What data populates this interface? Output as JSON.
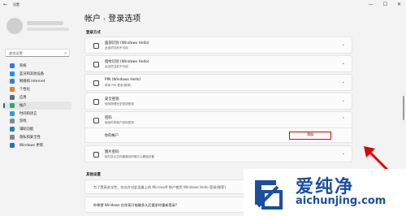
{
  "window": {
    "title": "设置",
    "controls": [
      "—",
      "☐",
      "✕"
    ],
    "back": "←"
  },
  "search": {
    "placeholder": "查找设置"
  },
  "sidebar": {
    "items": [
      {
        "label": "系统",
        "color": "#2b7de9"
      },
      {
        "label": "蓝牙和其他设备",
        "color": "#1e90ff"
      },
      {
        "label": "网络和 Internet",
        "color": "#3a7bd5"
      },
      {
        "label": "个性化",
        "color": "#e67e22"
      },
      {
        "label": "应用",
        "color": "#5a6c86"
      },
      {
        "label": "帐户",
        "color": "#27ae60"
      },
      {
        "label": "时间和语言",
        "color": "#2d9cdb"
      },
      {
        "label": "游戏",
        "color": "#7f8c8d"
      },
      {
        "label": "辅助功能",
        "color": "#2980b9"
      },
      {
        "label": "隐私和安全性",
        "color": "#7f8c8d"
      },
      {
        "label": "Windows 更新",
        "color": "#1e73be"
      }
    ],
    "active_index": 5
  },
  "breadcrumb": {
    "parent": "帐户",
    "separator": "›",
    "current": "登录选项"
  },
  "sections": {
    "signin": "登录方式",
    "additional": "其他设置"
  },
  "cards": [
    {
      "title": "面部识别 (Windows Hello)",
      "sub": "此选项当前不可用",
      "icon": "face-icon"
    },
    {
      "title": "指纹识别 (Windows Hello)",
      "sub": "此选项当前不可用",
      "icon": "fingerprint-icon"
    },
    {
      "title": "PIN (Windows Hello)",
      "sub": "使用 PIN 登录(推荐)",
      "icon": "pin-icon"
    },
    {
      "title": "安全密钥",
      "sub": "使用物理安全密钥登录",
      "icon": "key-icon"
    },
    {
      "title": "密码",
      "sub": "使用你的帐户密码登录",
      "icon": "password-icon"
    }
  ],
  "password_row": {
    "label": "你的帐户",
    "button": "添加"
  },
  "picture_card": {
    "title": "图片密码",
    "sub": "轻扫并点击你最喜欢的照片以解锁设备",
    "icon": "picture-icon"
  },
  "extra": [
    "为了提高安全性，仅允许对此设备上的 Microsoft 帐户使用 Windows Hello 登录(推荐)",
    "你希望 Windows 在你离开电脑多久后要求你重新登录?"
  ],
  "watermark": {
    "cn": "爱纯净",
    "url": "aichunjing.com"
  }
}
